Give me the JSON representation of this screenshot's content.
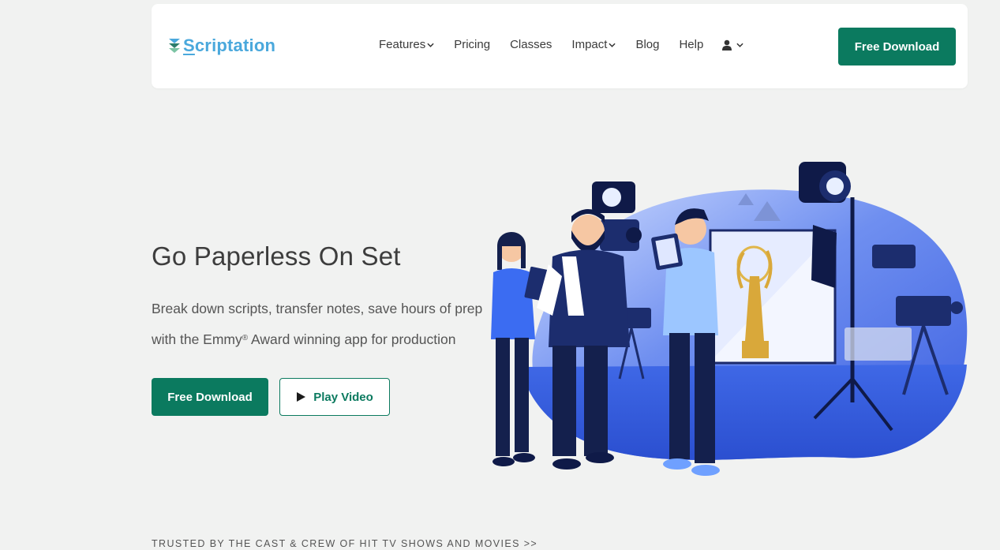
{
  "header": {
    "logo": {
      "prefix": "S",
      "rest": "criptation"
    },
    "nav": [
      {
        "label": "Features",
        "has_dropdown": true
      },
      {
        "label": "Pricing",
        "has_dropdown": false
      },
      {
        "label": "Classes",
        "has_dropdown": false
      },
      {
        "label": "Impact",
        "has_dropdown": true
      },
      {
        "label": "Blog",
        "has_dropdown": false
      },
      {
        "label": "Help",
        "has_dropdown": false
      }
    ],
    "user_icon": "user-icon",
    "cta_label": "Free Download"
  },
  "hero": {
    "title": "Go Paperless On Set",
    "subtitle_line1": "Break down scripts, transfer notes, save hours of prep",
    "subtitle_line2_pre": "with the Emmy",
    "subtitle_reg": "®",
    "subtitle_line2_post": " Award winning app for production",
    "primary_cta": "Free Download",
    "secondary_cta": "Play Video",
    "illustration_icon": "film-crew-illustration"
  },
  "trusted_text": "TRUSTED BY THE CAST & CREW OF HIT TV SHOWS AND MOVIES >>",
  "colors": {
    "brand": "#0b7a5f",
    "logo": "#4aa8dc",
    "background": "#f1f2f1",
    "illustration_blue": "#3f68e6"
  }
}
